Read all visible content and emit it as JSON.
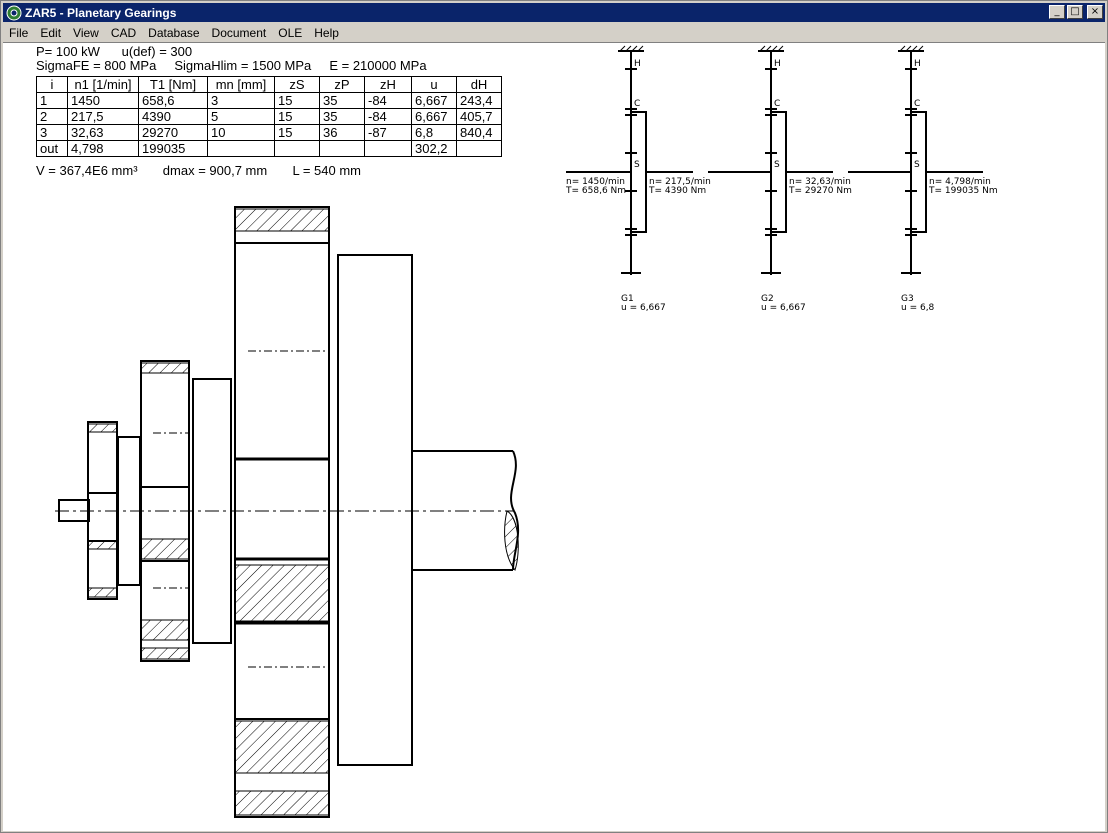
{
  "window": {
    "title": "ZAR5 - Planetary Gearings",
    "minimize": "_",
    "maximize": "□",
    "close": "×"
  },
  "menu": [
    "File",
    "Edit",
    "View",
    "CAD",
    "Database",
    "Document",
    "OLE",
    "Help"
  ],
  "summary": {
    "line1": "P= 100 kW      u(def) = 300",
    "line2": "SigmaFE = 800 MPa     SigmaHlim = 1500 MPa     E = 210000 MPa",
    "line3": "V = 367,4E6 mm³       dmax = 900,7 mm       L = 540 mm"
  },
  "table": {
    "headers": [
      "i",
      "n1 [1/min]",
      "T1 [Nm]",
      "mn [mm]",
      "zS",
      "zP",
      "zH",
      "u",
      "dH"
    ],
    "rows": [
      [
        "1",
        "1450",
        "658,6",
        "3",
        "15",
        "35",
        "-84",
        "6,667",
        "243,4"
      ],
      [
        "2",
        "217,5",
        "4390",
        "5",
        "15",
        "35",
        "-84",
        "6,667",
        "405,7"
      ],
      [
        "3",
        "32,63",
        "29270",
        "10",
        "15",
        "36",
        "-87",
        "6,8",
        "840,4"
      ],
      [
        "out",
        "4,798",
        "199035",
        "",
        "",
        "",
        "",
        "302,2",
        ""
      ]
    ]
  },
  "scheme": {
    "labels": {
      "h": "H",
      "c": "C",
      "s": "S"
    },
    "stages": [
      {
        "name": "G1",
        "ratio": "u = 6,667"
      },
      {
        "name": "G2",
        "ratio": "u = 6,667"
      },
      {
        "name": "G3",
        "ratio": "u = 6,8"
      }
    ],
    "shafts": [
      {
        "n": "n= 1450/min",
        "t": "T= 658,6 Nm"
      },
      {
        "n": "n= 217,5/min",
        "t": "T= 4390 Nm"
      },
      {
        "n": "n= 32,63/min",
        "t": "T= 29270 Nm"
      },
      {
        "n": "n= 4,798/min",
        "t": "T= 199035 Nm"
      }
    ]
  },
  "drawing": {
    "note": "b-1505-1720-8"
  }
}
